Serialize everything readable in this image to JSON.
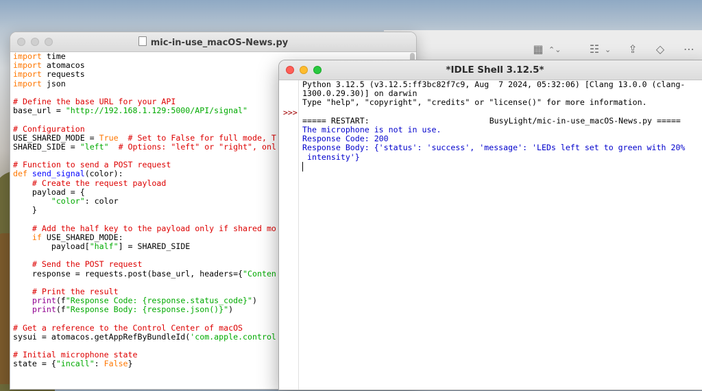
{
  "editor": {
    "title": "mic-in-use_macOS-News.py",
    "lines": [
      {
        "t": "import",
        "r": " time"
      },
      {
        "t": "import",
        "r": " atomacos"
      },
      {
        "t": "import",
        "r": " requests"
      },
      {
        "t": "import",
        "r": " json"
      },
      {
        "blank": true
      },
      {
        "c": "# Define the base URL for your API"
      },
      {
        "a": "base_url = ",
        "s": "\"http://192.168.1.129:5000/API/signal\""
      },
      {
        "blank": true
      },
      {
        "c": "# Configuration"
      },
      {
        "a": "USE_SHARED_MODE = ",
        "k": "True",
        "c": "  # Set to False for full mode, T"
      },
      {
        "a": "SHARED_SIDE = ",
        "s": "\"left\"",
        "c": "  # Options: \"left\" or \"right\", onl"
      },
      {
        "blank": true
      },
      {
        "c": "# Function to send a POST request"
      },
      {
        "k": "def ",
        "f": "send_signal",
        "a": "(color):"
      },
      {
        "a": "    ",
        "c": "# Create the request payload"
      },
      {
        "a": "    payload = {"
      },
      {
        "a": "        ",
        "s": "\"color\"",
        "r": ": color"
      },
      {
        "a": "    }"
      },
      {
        "blank": true
      },
      {
        "a": "    ",
        "c": "# Add the half key to the payload only if shared mo"
      },
      {
        "a": "    ",
        "k": "if",
        "r": " USE_SHARED_MODE:"
      },
      {
        "a": "        payload[",
        "s": "\"half\"",
        "r": "] = SHARED_SIDE"
      },
      {
        "blank": true
      },
      {
        "a": "    ",
        "c": "# Send the POST request"
      },
      {
        "a": "    response = requests.post(base_url, headers={",
        "s": "\"Conten"
      },
      {
        "blank": true
      },
      {
        "a": "    ",
        "c": "# Print the result"
      },
      {
        "a": "    ",
        "b": "print",
        "r": "(f",
        "s": "\"Response Code: {response.status_code}\"",
        "e": ")"
      },
      {
        "a": "    ",
        "b": "print",
        "r": "(f",
        "s": "\"Response Body: {response.json()}\"",
        "e": ")"
      },
      {
        "blank": true
      },
      {
        "c": "# Get a reference to the Control Center of macOS"
      },
      {
        "a": "sysui = atomacos.getAppRefByBundleId(",
        "s": "'com.apple.control"
      },
      {
        "blank": true
      },
      {
        "c": "# Initial microphone state"
      },
      {
        "a": "state = {",
        "s": "\"incall\"",
        "r": ": ",
        "k": "False",
        "e": "}"
      }
    ]
  },
  "shell": {
    "title": "*IDLE Shell 3.12.5*",
    "prompt": ">>>",
    "banner_line1": "Python 3.12.5 (v3.12.5:ff3bc82f7c9, Aug  7 2024, 05:32:06) [Clang 13.0.0 (clang-",
    "banner_line2": "1300.0.29.30)] on darwin",
    "banner_line3": "Type \"help\", \"copyright\", \"credits\" or \"license()\" for more information.",
    "restart_prefix": "===== RESTART: ",
    "restart_suffix": "BusyLight/mic-in-use_macOS-News.py =====",
    "output_line1": "The microphone is not in use.",
    "output_line2": "Response Code: 200",
    "output_line3": "Response Body: {'status': 'success', 'message': 'LEDs left set to green with 20%",
    "output_line4": " intensity'}"
  },
  "toolbar": {
    "icons": [
      "grid-view-icon",
      "chevron-updown-icon",
      "list-view-icon",
      "chevron-down-icon",
      "share-icon",
      "tag-icon",
      "more-icon"
    ]
  }
}
